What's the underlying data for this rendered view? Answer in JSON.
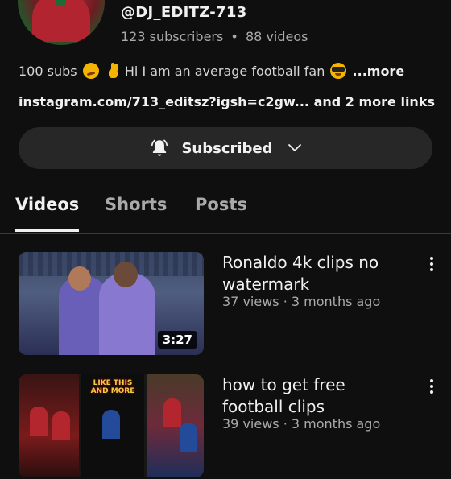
{
  "channel": {
    "handle": "@DJ_EDITZ-713",
    "subscribers": "123 subscribers",
    "separator": "•",
    "videos_count": "88 videos",
    "description_start": "100 subs",
    "description_text": "Hi I am an average football fan",
    "more_label": "...more",
    "links_text": "instagram.com/713_editsz?igsh=c2gw... and 2 more links"
  },
  "subscribe_button": {
    "label": "Subscribed",
    "icon": "bell-icon"
  },
  "tabs": [
    {
      "label": "Videos",
      "active": true
    },
    {
      "label": "Shorts",
      "active": false
    },
    {
      "label": "Posts",
      "active": false
    }
  ],
  "videos": [
    {
      "title": "Ronaldo 4k clips no watermark",
      "meta": "37 views · 3 months ago",
      "duration": "3:27"
    },
    {
      "title": "how to get free football clips",
      "meta": "39 views · 3 months ago",
      "thumb_text": "LIKE THIS AND MORE"
    }
  ],
  "colors": {
    "background": "#0f0f0f",
    "button_bg": "#272727",
    "secondary_text": "#aaaaaa"
  }
}
